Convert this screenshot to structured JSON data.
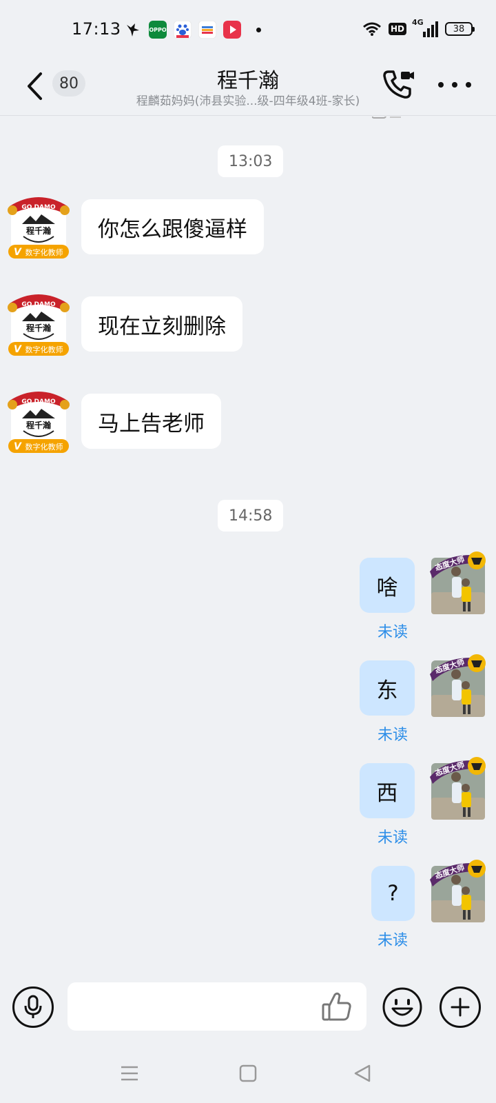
{
  "status_bar": {
    "time": "17:13",
    "network": "4G",
    "hd_label": "HD",
    "battery": "38",
    "app_icons": [
      {
        "name": "bird-app-icon",
        "color": "#111111"
      },
      {
        "name": "oppo-app-icon",
        "color": "#0e8a3c",
        "label": "OPPO"
      },
      {
        "name": "baidu-app-icon",
        "color": "#2a5fd8"
      },
      {
        "name": "wallet-app-icon",
        "color": "#f5a623"
      },
      {
        "name": "video-app-icon",
        "color": "#e8334a"
      }
    ]
  },
  "header": {
    "unread_count": "80",
    "title": "程千瀚",
    "subtitle": "程麟茹妈妈(沛县实验...级-四年级4班-家长)"
  },
  "incoming_avatar": {
    "banner_text": "GO DAMO",
    "name_text": "程千瀚",
    "badge_text": "数字化教师",
    "badge_v": "V"
  },
  "outgoing_avatar": {
    "sticker_text": "态度大师"
  },
  "messages": {
    "time_1": "13:03",
    "incoming": [
      {
        "text": "你怎么跟傻逼样"
      },
      {
        "text": "现在立刻删除"
      },
      {
        "text": "马上告老师"
      }
    ],
    "time_2": "14:58",
    "outgoing": [
      {
        "text": "啥",
        "status": "未读"
      },
      {
        "text": "东",
        "status": "未读"
      },
      {
        "text": "西",
        "status": "未读"
      },
      {
        "text": "?",
        "status": "未读"
      }
    ]
  },
  "input": {
    "placeholder": ""
  },
  "colors": {
    "background": "#eff1f4",
    "outgoing_bubble": "#cde6ff",
    "unread_status": "#2d8ee8",
    "badge_orange": "#f5a300"
  }
}
